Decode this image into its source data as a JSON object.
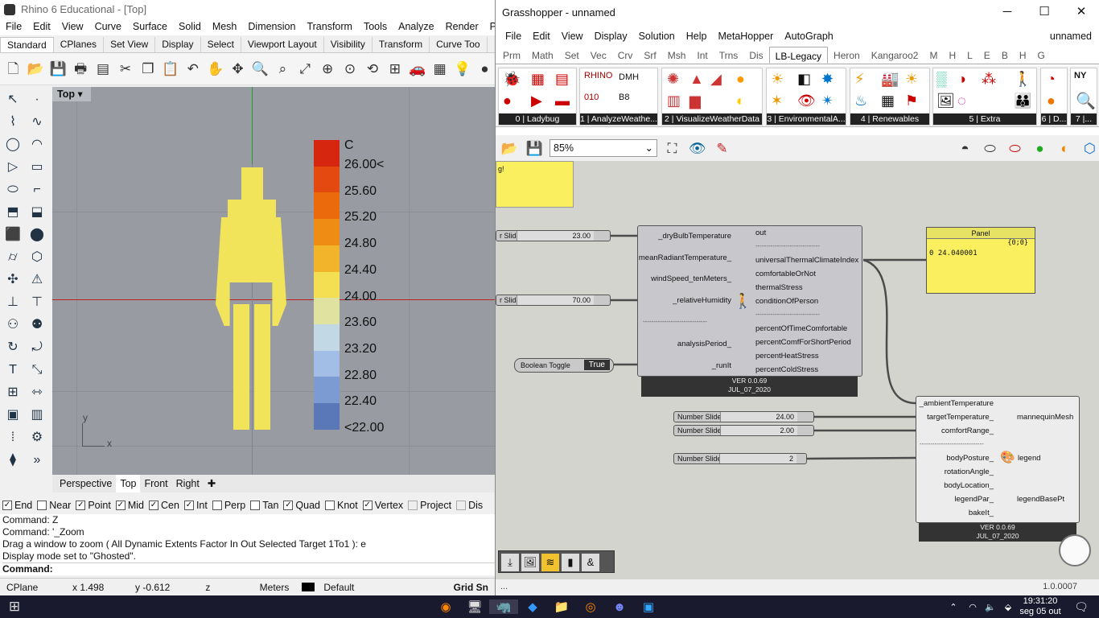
{
  "rhino": {
    "title": "Rhino 6 Educational - [Top]",
    "menu": [
      "File",
      "Edit",
      "View",
      "Curve",
      "Surface",
      "Solid",
      "Mesh",
      "Dimension",
      "Transform",
      "Tools",
      "Analyze",
      "Render",
      "Panels"
    ],
    "tabs": [
      "Standard",
      "CPlanes",
      "Set View",
      "Display",
      "Select",
      "Viewport Layout",
      "Visibility",
      "Transform",
      "Curve Too"
    ],
    "viewport_name": "Top",
    "axis_x": "x",
    "axis_y": "y",
    "legend": {
      "unit": "C",
      "labels": [
        "26.00<",
        "25.60",
        "25.20",
        "24.80",
        "24.40",
        "24.00",
        "23.60",
        "23.20",
        "22.80",
        "22.40",
        "<22.00"
      ],
      "colors": [
        "#d62610",
        "#e44a10",
        "#ea6a0c",
        "#ee8c14",
        "#f2b42a",
        "#f4df52",
        "#e0e2a0",
        "#c2d8e4",
        "#a2bee6",
        "#7b9bd2",
        "#5a77b8"
      ]
    },
    "view_tabs": [
      "Perspective",
      "Top",
      "Front",
      "Right"
    ],
    "osnaps": [
      {
        "label": "End",
        "checked": true
      },
      {
        "label": "Near",
        "checked": false
      },
      {
        "label": "Point",
        "checked": true
      },
      {
        "label": "Mid",
        "checked": true
      },
      {
        "label": "Cen",
        "checked": true
      },
      {
        "label": "Int",
        "checked": true
      },
      {
        "label": "Perp",
        "checked": false
      },
      {
        "label": "Tan",
        "checked": false
      },
      {
        "label": "Quad",
        "checked": true
      },
      {
        "label": "Knot",
        "checked": false
      },
      {
        "label": "Vertex",
        "checked": true
      },
      {
        "label": "Project",
        "checked": false
      },
      {
        "label": "Dis",
        "checked": false
      }
    ],
    "command_history": [
      "Command: Z",
      "Command: '_Zoom",
      "Drag a window to zoom ( All  Dynamic  Extents  Factor  In  Out  Selected  Target  1To1 ): e",
      "Display mode set to \"Ghosted\"."
    ],
    "command_prompt": "Command:",
    "status": {
      "cplane": "CPlane",
      "x": "x 1.498",
      "y": "y -0.612",
      "z": "z",
      "units": "Meters",
      "layer": "Default",
      "grid_snap": "Grid Sn"
    }
  },
  "gh": {
    "title": "Grasshopper - unnamed",
    "menu": [
      "File",
      "Edit",
      "View",
      "Display",
      "Solution",
      "Help",
      "MetaHopper",
      "AutoGraph"
    ],
    "doc_name": "unnamed",
    "tabs": [
      "Prm",
      "Math",
      "Set",
      "Vec",
      "Crv",
      "Srf",
      "Msh",
      "Int",
      "Trns",
      "Dis",
      "LB-Legacy",
      "Heron",
      "Kangaroo2",
      "M",
      "H",
      "L",
      "E",
      "B",
      "H",
      "G"
    ],
    "ribbon_groups": [
      "0 | Ladybug",
      "1 | AnalyzeWeathe...",
      "2 | VisualizeWeatherData",
      "3 | EnvironmentalA...",
      "4 | Renewables",
      "5 | Extra",
      "6 | D...",
      "7 |..."
    ],
    "zoom": "85%",
    "panel_text": "g!",
    "sliders": [
      {
        "name": "r Slider",
        "value": "23.00"
      },
      {
        "name": "r Slider",
        "value": "70.00"
      },
      {
        "name": "Number Slider",
        "value": "24.00"
      },
      {
        "name": "Number Slider",
        "value": "2.00"
      },
      {
        "name": "Number Slider",
        "value": "2"
      }
    ],
    "toggle": {
      "name": "Boolean Toggle",
      "value": "True"
    },
    "utci": {
      "inputs": [
        "_dryBulbTemperature",
        "meanRadiantTemperature_",
        "windSpeed_tenMeters_",
        "_relativeHumidity",
        "------------------------------",
        "analysisPeriod_",
        "_runIt"
      ],
      "outputs": [
        "out",
        "------------------------------",
        "universalThermalClimateIndex",
        "comfortableOrNot",
        "thermalStress",
        "conditionOfPerson",
        "------------------------------",
        "percentOfTimeComfortable",
        "percentComfForShortPeriod",
        "percentHeatStress",
        "percentColdStress"
      ],
      "version": "VER 0.0.69",
      "date": "JUL_07_2020"
    },
    "panel": {
      "title": "Panel",
      "path": "{0;0}",
      "index": "0",
      "value": "24.040001"
    },
    "mannequin": {
      "inputs": [
        "_ambientTemperature",
        "targetTemperature_",
        "comfortRange_",
        "------------------------------",
        "bodyPosture_",
        "rotationAngle_",
        "bodyLocation_",
        "legendPar_",
        "bakeIt_"
      ],
      "outputs": [
        "mannequinMesh",
        "legend",
        "legendBasePt"
      ],
      "version": "VER 0.0.69",
      "date": "JUL_07_2020"
    },
    "status_left": "...",
    "version": "1.0.0007"
  },
  "taskbar": {
    "time": "19:31:20",
    "date": "seg 05 out"
  }
}
